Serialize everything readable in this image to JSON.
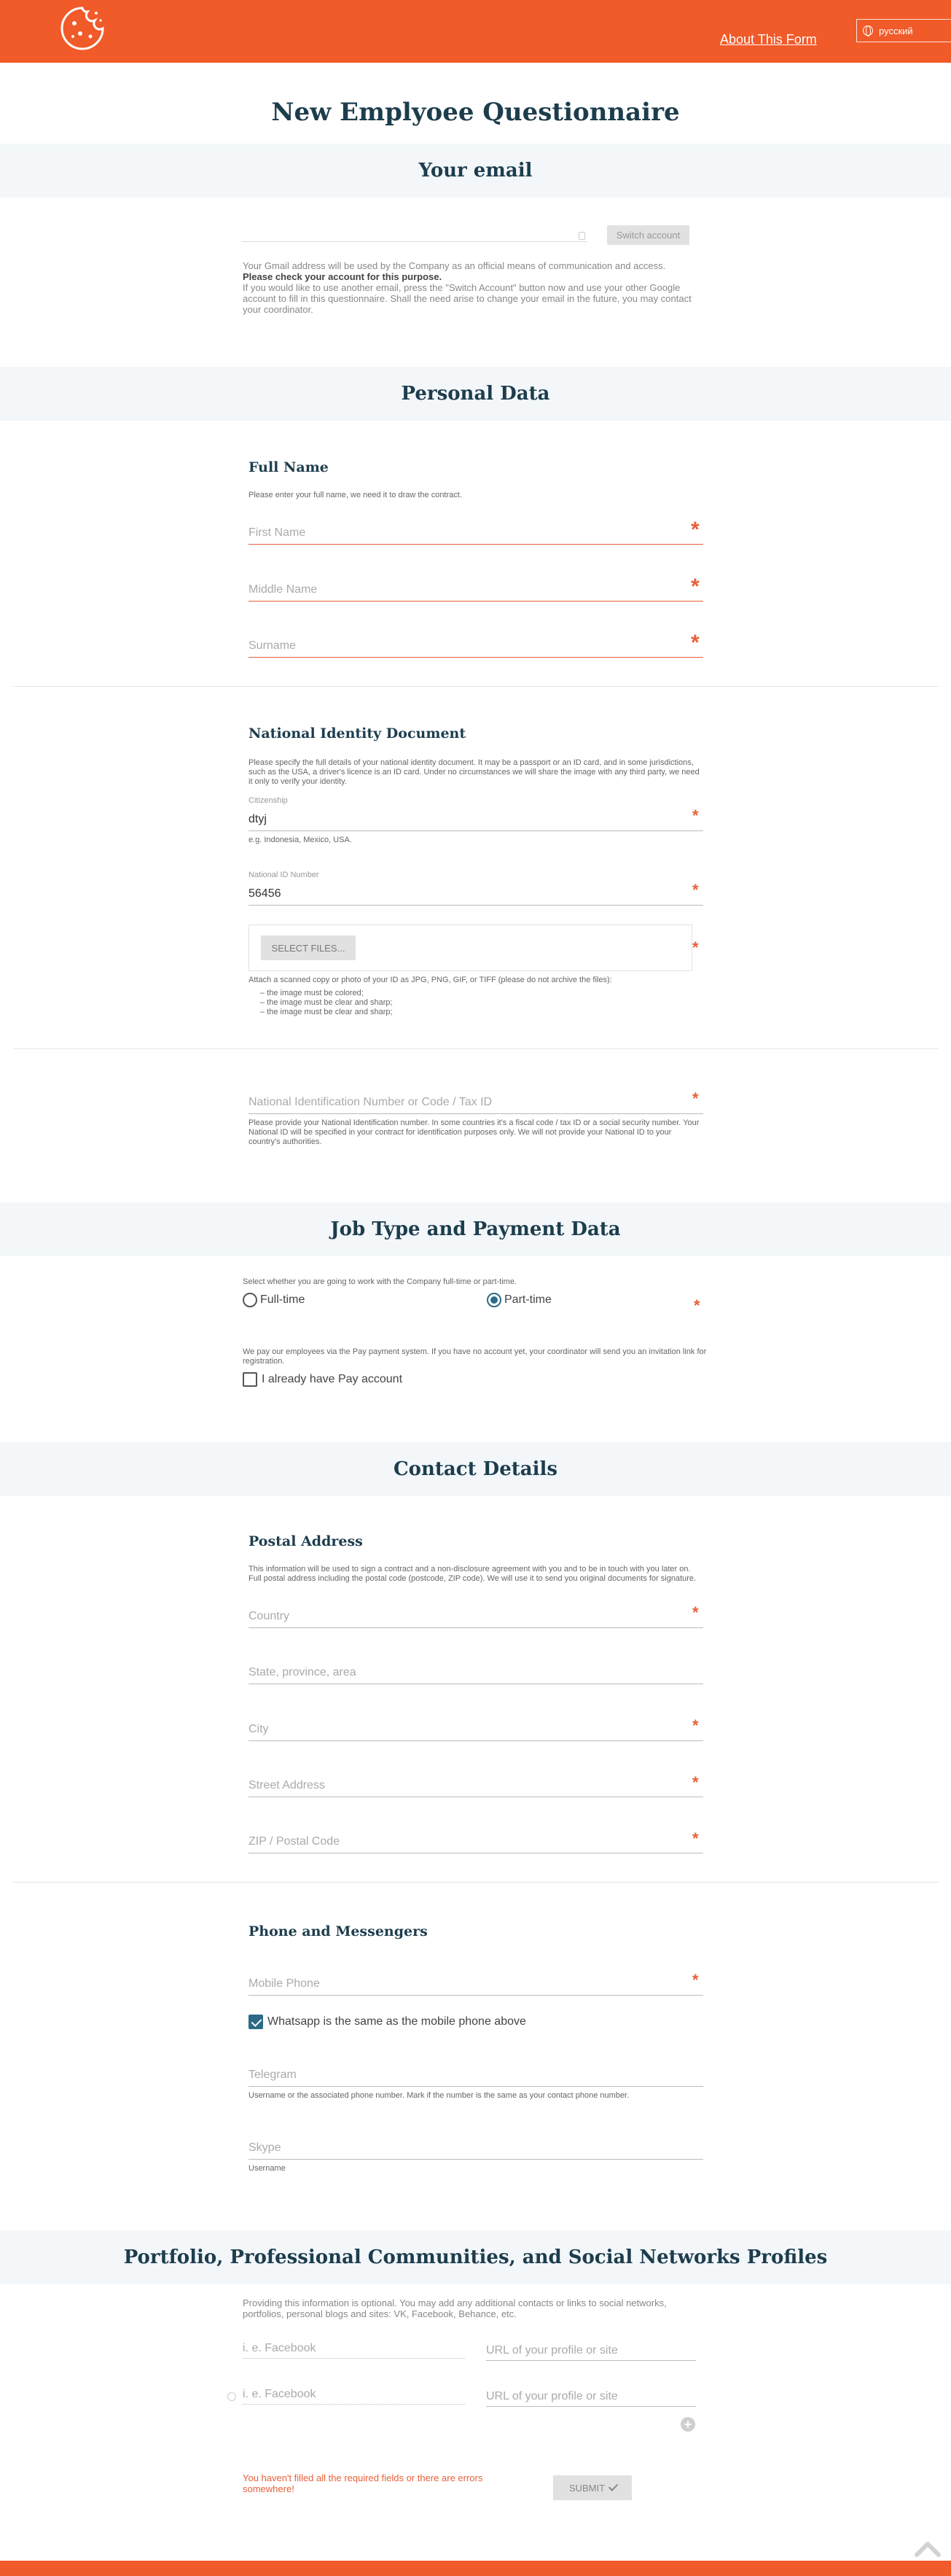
{
  "header": {
    "about_link": "About This Form",
    "language": "русский"
  },
  "page_title": "New Emplyoee Questionnaire",
  "email_section": {
    "title": "Your email",
    "switch_button": "Switch account",
    "info_line1": "Your Gmail address will be used by the Company as an official means of communication and access.",
    "info_bold": "Please check your account for this purpose.",
    "info_line2": "If you would like to use another email, press the \"Switch Account\" button now and use your other Google account to fill in this questionnaire. Shall the need arise to change your email in the future, you may contact your coordinator."
  },
  "personal_section": {
    "title": "Personal Data",
    "full_name": {
      "title": "Full Name",
      "description": "Please enter your full name, we need it to draw the contract.",
      "first_name_placeholder": "First Name",
      "middle_name_placeholder": "Middle Name",
      "surname_placeholder": "Surname"
    },
    "identity": {
      "title": "National Identity Document",
      "description": "Please specify the full details of your national identity document. It may be a passport or an ID card, and in some jurisdictions, such as the USA, a driver's licence is an ID card. Under no circumstances we will share the image with any third party, we need it only to verify your identity.",
      "citizenship_label": "Citizenship",
      "citizenship_value": "dtyj",
      "citizenship_hint": "e.g. Indonesia, Mexico, USA.",
      "national_id_label": "National ID Number",
      "national_id_value": "56456",
      "select_files_button": "SELECT FILES...",
      "attach_hint": "Attach a scanned copy or photo of your ID as JPG, PNG, GIF, or TIFF (please do not archive the files):",
      "attach_rules": [
        "– the image must be colored;",
        "– the image must be clear and sharp;",
        "– the image must be clear and sharp;"
      ]
    },
    "tax": {
      "placeholder": "National Identification Number or Code / Tax ID",
      "description": "Please provide your National Identification number. In some countries it's a fiscal code / tax ID or a social security number. Your National ID will be specified in your contract for identification purposes only. We will not provide your National ID to your country's authorities."
    }
  },
  "job_section": {
    "title": "Job Type and Payment Data",
    "select_hint": "Select whether you are going to work with the Company full-time or part-time.",
    "option_full": "Full-time",
    "option_part": "Part-time",
    "selected": "Part-time",
    "pay_hint": "We pay our employees via the Pay payment system. If you have no account yet, your coordinator will send you an invitation link for registration.",
    "pay_checkbox": "I already have Pay account"
  },
  "contact_section": {
    "title": "Contact Details",
    "postal": {
      "title": "Postal Address",
      "description": "This information will be used to sign a contract and a non-disclosure agreement with you and to be in touch with you later on. Full postal address including the postal code (postcode, ZIP code). We will use it to send you original documents for signature.",
      "country": "Country",
      "state": "State, province, area",
      "city": "City",
      "street": "Street Address",
      "zip": "ZIP / Postal Code"
    },
    "phone": {
      "title": "Phone and Messengers",
      "mobile": "Mobile Phone",
      "whatsapp_checkbox": "Whatsapp is the same as the mobile phone above",
      "telegram": "Telegram",
      "telegram_hint": "Username or the associated phone number. Mark if the number is the same as your contact phone number.",
      "skype": "Skype",
      "skype_hint": "Username"
    }
  },
  "portfolio_section": {
    "title": "Portfolio, Professional Communities, and Social Networks Profiles",
    "description": "Providing this information is optional. You may add any additional contacts or links to social networks, portfolios, personal blogs and sites: VK, Facebook, Behance, etc.",
    "rows": [
      {
        "name_placeholder": "i. e. Facebook",
        "url_placeholder": "URL of your profile or site"
      },
      {
        "name_placeholder": "i. e. Facebook",
        "url_placeholder": "URL of your profile or site"
      }
    ]
  },
  "footer": {
    "error_message": "You haven't filled all the required fields or there are errors somewhere!",
    "submit_button": "SUBMIT"
  },
  "colors": {
    "brand": "#f15a29",
    "heading": "#1d3d4d",
    "accent": "#2c6a87",
    "error": "#e8603a"
  }
}
